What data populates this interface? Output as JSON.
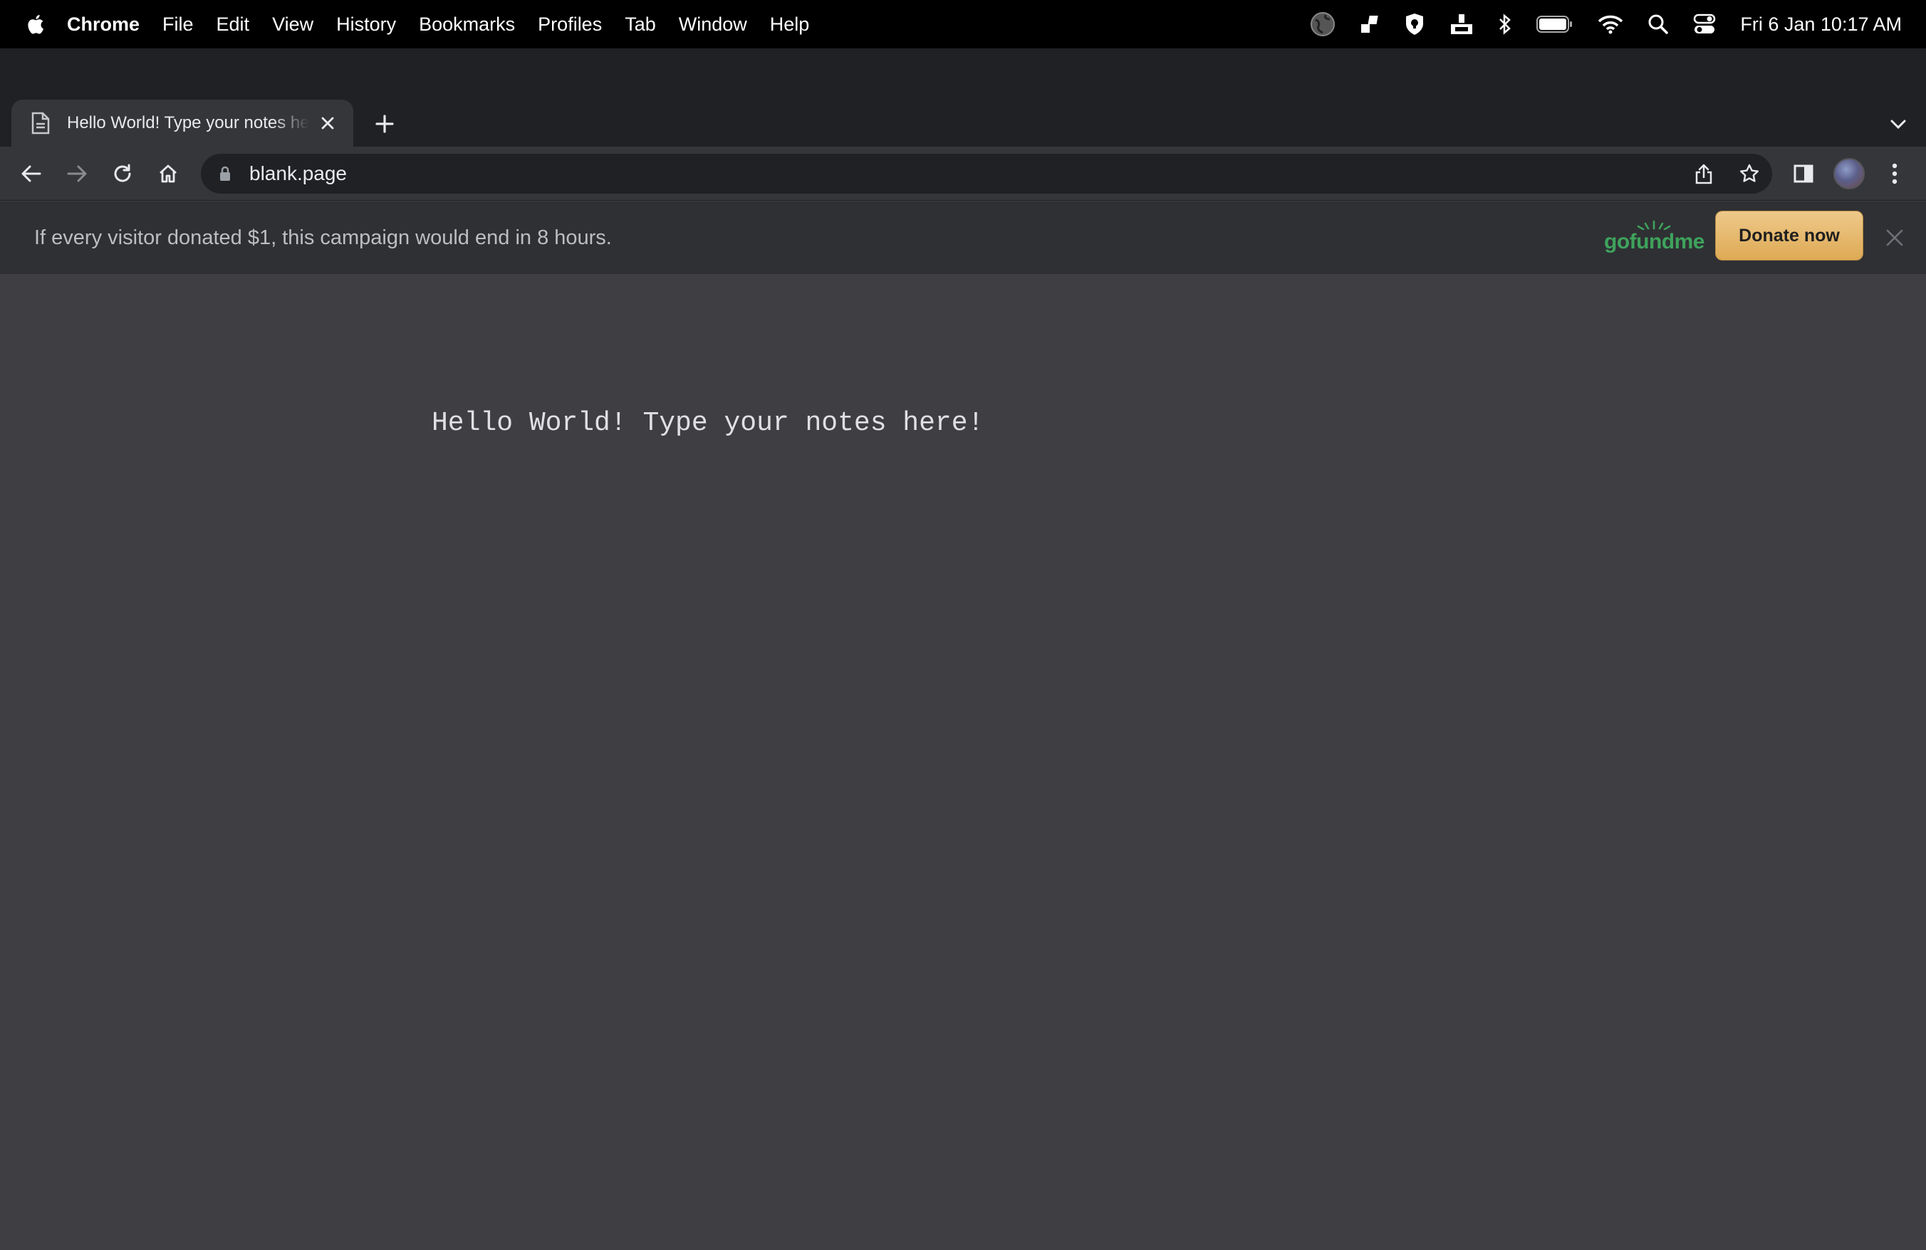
{
  "menubar": {
    "app_name": "Chrome",
    "items": [
      "File",
      "Edit",
      "View",
      "History",
      "Bookmarks",
      "Profiles",
      "Tab",
      "Window",
      "Help"
    ],
    "clock": "Fri 6 Jan  10:17 AM",
    "status_icons": [
      "globe-icon",
      "app-icon",
      "shield-icon",
      "network-icon",
      "bluetooth-icon",
      "battery-icon",
      "wifi-icon",
      "spotlight-icon",
      "control-center-icon"
    ]
  },
  "tab": {
    "title": "Hello World! Type your notes here!"
  },
  "toolbar": {
    "url": "blank.page"
  },
  "banner": {
    "message": "If every visitor donated $1, this campaign would end in 8 hours.",
    "logo_text": "gofundme",
    "donate_label": "Donate now"
  },
  "content": {
    "note_text": "Hello World! Type your notes here!"
  },
  "colors": {
    "page_bg": "#3f3e43",
    "tabstrip_bg": "#202124",
    "toolbar_bg": "#35363a",
    "gofundme_green": "#3ea35c",
    "donate_button": "#e7b96c"
  }
}
